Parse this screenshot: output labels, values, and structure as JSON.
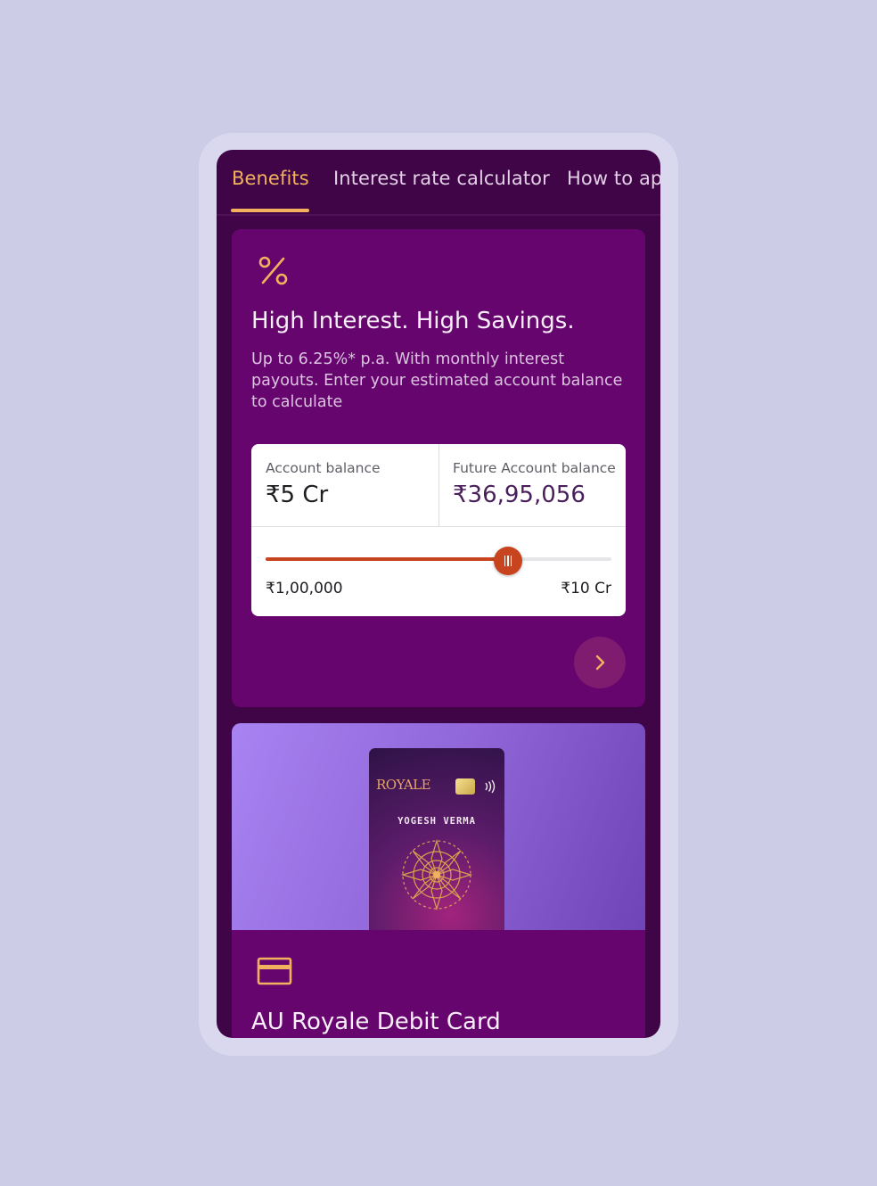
{
  "tabs": [
    "Benefits",
    "Interest rate calculator",
    "How to ap"
  ],
  "benefit": {
    "title": "High Interest. High Savings.",
    "description": "Up to 6.25%* p.a. With monthly interest payouts. Enter your estimated account balance to calculate"
  },
  "calculator": {
    "balance_label": "Account balance",
    "balance_value": "₹5 Cr",
    "future_label": "Future Account balance",
    "future_value": "₹36,95,056",
    "slider_min": "₹1,00,000",
    "slider_max": "₹10 Cr",
    "slider_level": 0.7
  },
  "debit_card": {
    "brand": "ROYALE",
    "holder": "YOGESH VERMA",
    "title": "AU Royale Debit Card"
  },
  "colors": {
    "accent": "#f2b15e",
    "card_bg": "#66056e",
    "screen_bg": "#3f0547",
    "slider": "#c7441f"
  }
}
